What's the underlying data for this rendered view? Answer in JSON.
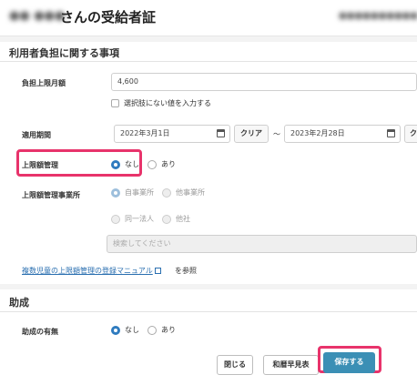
{
  "header": {
    "title_blurred": "●● ●●●",
    "title": "さんの受給者証",
    "right_blurred": "●●●●●●●●●●"
  },
  "user_burden": {
    "section_title": "利用者負担に関する事項",
    "limit_label": "負担上限月額",
    "limit_value": "4,600",
    "unlisted_label": "選択肢にない値を入力する",
    "period_label": "適用期間",
    "start_date": "2022年3月1日",
    "clear_label": "クリア",
    "tilde": "〜",
    "end_date": "2023年2月28日",
    "end_clear_label": "ク",
    "mgmt_label": "上限額管理",
    "mgmt_options": [
      "なし",
      "あり"
    ],
    "mgmt_selected": "なし",
    "office_label": "上限額管理事業所",
    "office_options": [
      "自事業所",
      "他事業所"
    ],
    "corp_options": [
      "同一法人",
      "他社"
    ],
    "search_placeholder": "検索してください",
    "manual_link": "複数児童の上限額管理の登録マニュアル",
    "manual_suffix": "を参照"
  },
  "subsidy": {
    "section_title": "助成",
    "presence_label": "助成の有無",
    "options": [
      "なし",
      "あり"
    ],
    "selected": "なし"
  },
  "footer": {
    "close_label": "閉じる",
    "calendar_label": "和暦早見表",
    "save_label": "保存する"
  },
  "colors": {
    "accent": "#2f7bbf",
    "primary_button": "#3b8fb5",
    "highlight": "#e8336b"
  }
}
